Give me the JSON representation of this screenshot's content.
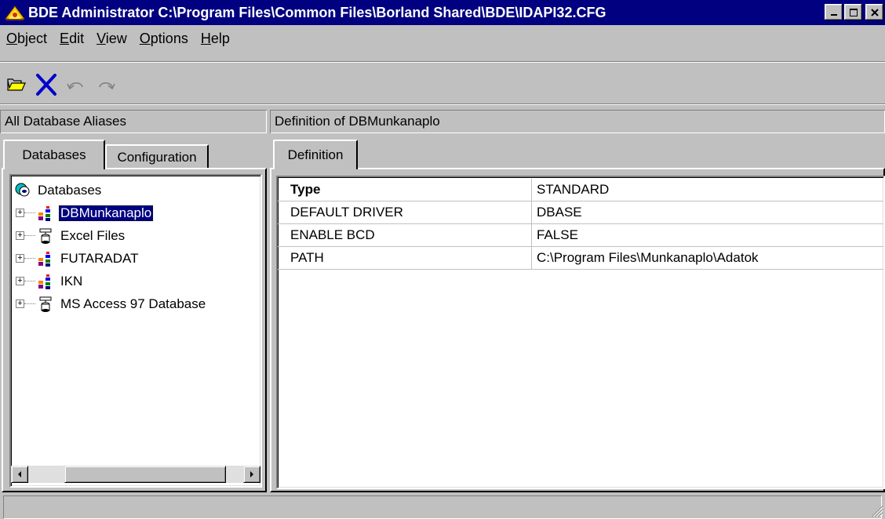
{
  "window": {
    "title": "BDE Administrator  C:\\Program Files\\Common Files\\Borland Shared\\BDE\\IDAPI32.CFG",
    "title_bar_color": "#000080"
  },
  "menu": [
    {
      "label": "Object",
      "accel": "O",
      "rest": "bject"
    },
    {
      "label": "Edit",
      "accel": "E",
      "rest": "dit"
    },
    {
      "label": "View",
      "accel": "V",
      "rest": "iew"
    },
    {
      "label": "Options",
      "accel": "O",
      "rest": "ptions"
    },
    {
      "label": "Help",
      "accel": "H",
      "rest": "elp"
    }
  ],
  "toolbar": {
    "icons": [
      "open-folder-icon",
      "delete-icon",
      "undo-icon",
      "redo-icon"
    ]
  },
  "left": {
    "header": "All Database Aliases",
    "tabs": [
      "Databases",
      "Configuration"
    ],
    "tree": {
      "root": "Databases",
      "items": [
        {
          "label": "DBMunkanaplo",
          "icon": "standard-db-icon",
          "selected": true
        },
        {
          "label": "Excel Files",
          "icon": "odbc-db-icon",
          "selected": false
        },
        {
          "label": "FUTARADAT",
          "icon": "standard-db-icon",
          "selected": false
        },
        {
          "label": "IKN",
          "icon": "standard-db-icon",
          "selected": false
        },
        {
          "label": "MS Access 97 Database",
          "icon": "odbc-db-icon",
          "selected": false
        }
      ]
    }
  },
  "right": {
    "header": "Definition of DBMunkanaplo",
    "tabs": [
      "Definition"
    ],
    "rows": [
      {
        "key": "Type",
        "value": "STANDARD",
        "bold": true
      },
      {
        "key": "DEFAULT DRIVER",
        "value": "DBASE",
        "bold": false
      },
      {
        "key": "ENABLE BCD",
        "value": "FALSE",
        "bold": false
      },
      {
        "key": "PATH",
        "value": "C:\\Program Files\\Munkanaplo\\Adatok",
        "bold": false
      }
    ]
  }
}
